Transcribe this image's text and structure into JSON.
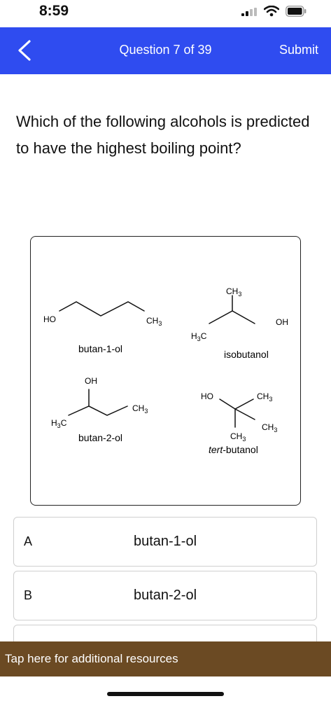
{
  "status": {
    "time": "8:59"
  },
  "nav": {
    "title": "Question 7 of 39",
    "submit": "Submit"
  },
  "question": {
    "text": "Which of the following alcohols is predicted to have the highest boiling point?"
  },
  "figure": {
    "butan1ol": {
      "name": "butan-1-ol",
      "ho": "HO",
      "ch3": "CH3"
    },
    "isobutanol": {
      "name": "isobutanol",
      "ch3": "CH3",
      "h3c": "H3C",
      "oh": "OH"
    },
    "butan2ol": {
      "name": "butan-2-ol",
      "oh": "OH",
      "h3c": "H3C",
      "ch3": "CH3"
    },
    "tertbutanol": {
      "name_italic": "tert",
      "name_rest": "-butanol",
      "ho": "HO",
      "ch3_a": "CH3",
      "ch3_b": "CH3",
      "ch3_c": "CH3"
    }
  },
  "options": [
    {
      "letter": "A",
      "text": "butan-1-ol"
    },
    {
      "letter": "B",
      "text": "butan-2-ol"
    }
  ],
  "resources": {
    "text": "Tap here for additional resources"
  }
}
